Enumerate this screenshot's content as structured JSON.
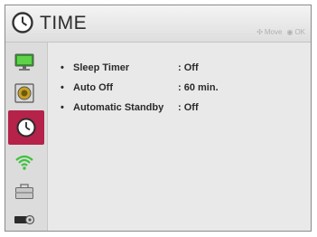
{
  "header": {
    "title": "TIME",
    "hint_move": "Move",
    "hint_ok": "OK"
  },
  "sidebar": {
    "items": [
      {
        "name": "picture",
        "icon": "monitor-icon"
      },
      {
        "name": "audio",
        "icon": "speaker-icon"
      },
      {
        "name": "time",
        "icon": "clock-icon",
        "active": true
      },
      {
        "name": "network",
        "icon": "wifi-icon"
      },
      {
        "name": "option",
        "icon": "toolbox-icon"
      },
      {
        "name": "input",
        "icon": "input-device-icon"
      }
    ]
  },
  "settings": [
    {
      "label": "Sleep Timer",
      "value": ": Off"
    },
    {
      "label": "Auto Off",
      "value": ": 60 min."
    },
    {
      "label": "Automatic Standby",
      "value": ": Off"
    }
  ],
  "colors": {
    "active": "#b5224a"
  }
}
